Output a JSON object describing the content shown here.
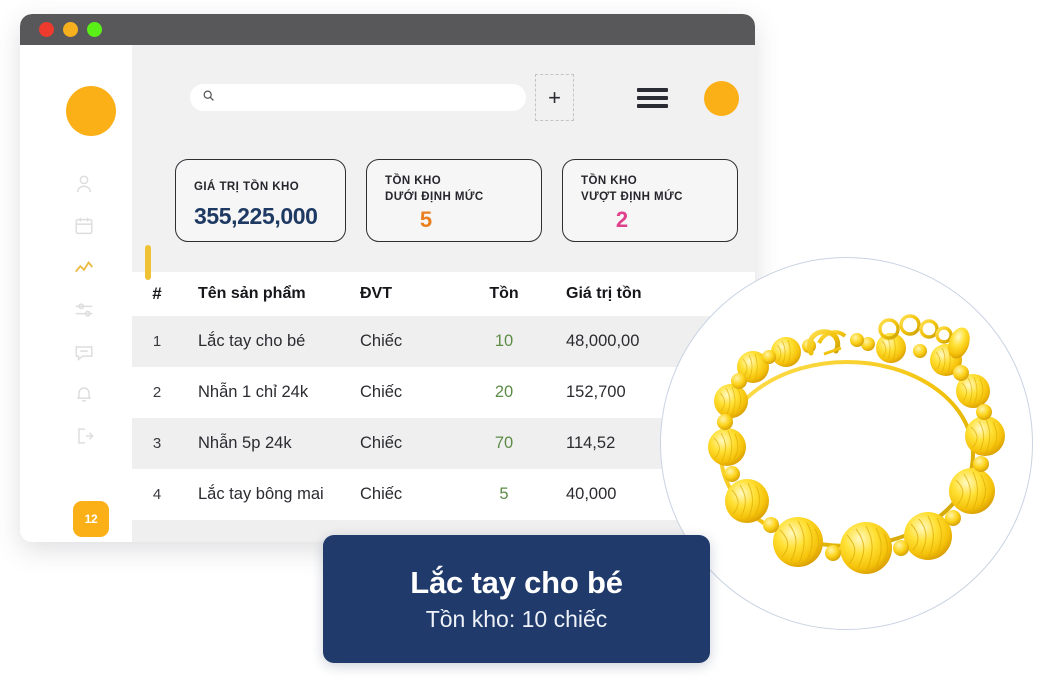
{
  "window": {
    "traffic_lights": [
      {
        "name": "close",
        "color": "#ee3b2e"
      },
      {
        "name": "minimize",
        "color": "#f6b01e"
      },
      {
        "name": "maximize",
        "color": "#5bef18"
      }
    ]
  },
  "sidebar": {
    "avatar": "user-avatar",
    "items": [
      {
        "icon": "user-icon",
        "label": "Khách hàng",
        "active": false
      },
      {
        "icon": "calendar-icon",
        "label": "Lịch",
        "active": false
      },
      {
        "icon": "chart-line-icon",
        "label": "Báo cáo",
        "active": true
      },
      {
        "icon": "sliders-icon",
        "label": "Cài đặt",
        "active": false
      },
      {
        "icon": "chat-icon",
        "label": "Tin nhắn",
        "active": false
      },
      {
        "icon": "bell-icon",
        "label": "Thông báo",
        "active": false
      },
      {
        "icon": "logout-icon",
        "label": "Đăng xuất",
        "active": false
      }
    ],
    "badge": "12"
  },
  "topbar": {
    "search": {
      "value": "",
      "placeholder": ""
    },
    "add_label": "+",
    "menu_icon": "hamburger-icon",
    "avatar": "account-avatar"
  },
  "kpis": [
    {
      "label": "GIÁ TRỊ TỒN KHO",
      "value": "355,225,000",
      "color": "#1e3a63",
      "style": "wide"
    },
    {
      "label": "TỒN KHO\nDƯỚI ĐỊNH MỨC",
      "label_line1": "TỒN KHO",
      "label_line2": "DƯỚI ĐỊNH MỨC",
      "value": "5",
      "color": "#ea7f22",
      "style": "small"
    },
    {
      "label": "TỒN KHO\nVƯỢT ĐỊNH MỨC",
      "label_line1": "TỒN KHO",
      "label_line2": "VƯỢT ĐỊNH MỨC",
      "value": "2",
      "color": "#e0418c",
      "style": "small"
    }
  ],
  "table": {
    "columns": [
      "#",
      "Tên sản phẩm",
      "ĐVT",
      "Tồn",
      "Giá trị tồn"
    ],
    "rows": [
      {
        "idx": "1",
        "name": "Lắc tay cho bé",
        "unit": "Chiếc",
        "qty": "10",
        "value": "48,000,00"
      },
      {
        "idx": "2",
        "name": "Nhẫn 1 chỉ 24k",
        "unit": "Chiếc",
        "qty": "20",
        "value": "152,700"
      },
      {
        "idx": "3",
        "name": "Nhẫn 5p 24k",
        "unit": "Chiếc",
        "qty": "70",
        "value": "114,52"
      },
      {
        "idx": "4",
        "name": "Lắc tay bông mai",
        "unit": "Chiếc",
        "qty": "5",
        "value": "40,000"
      }
    ]
  },
  "product": {
    "image": "gold-bead-bracelet",
    "caption_title": "Lắc tay cho bé",
    "caption_sub": "Tồn kho: 10 chiếc"
  },
  "colors": {
    "brand_orange": "#fbb018",
    "navy": "#1f3a6b",
    "value_navy": "#1e3a63",
    "under_orange": "#ea7f22",
    "over_pink": "#e0418c",
    "qty_green": "#5e8c47",
    "titlebar": "#58585a",
    "panel_gray": "#f1f1f1",
    "row_alt": "#efefef",
    "circle_border": "#c9d3e2"
  }
}
